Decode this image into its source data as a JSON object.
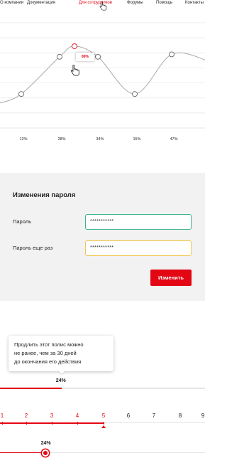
{
  "nav": {
    "items": [
      {
        "label": "О компании",
        "active": false
      },
      {
        "label": "Документация",
        "active": false
      },
      {
        "label": "Для сотрудников",
        "active": true
      },
      {
        "label": "Форумы",
        "active": false
      },
      {
        "label": "Помощь",
        "active": false
      },
      {
        "label": "Контакты",
        "active": false
      }
    ]
  },
  "chart_data": {
    "type": "line",
    "categories": [
      "12%",
      "28%",
      "34%",
      "15%",
      "47%"
    ],
    "points": [
      {
        "category": "12%",
        "value": 42
      },
      {
        "category": "28%",
        "value": 88
      },
      {
        "category": "",
        "value": 101
      },
      {
        "category": "34%",
        "value": 88
      },
      {
        "category": "15%",
        "value": 42
      },
      {
        "category": "47%",
        "value": 91
      }
    ],
    "tooltip": {
      "label": "89%"
    },
    "colors": {
      "line": "#aaaaaa",
      "grid": "#e6e6e6",
      "highlight": "#e30613"
    },
    "grid": true,
    "ylim": [
      0,
      130
    ]
  },
  "password_form": {
    "title": "Изменения пароля",
    "password_label": "Пароль",
    "password_value": "***********",
    "repeat_label": "Пароль еще раз",
    "repeat_value": "***********",
    "submit_label": "Изменить"
  },
  "hint": {
    "text_line1": "Продлить этот полис можно",
    "text_line2": "не ранее, чем за 30 дней",
    "text_line3": "до окончания его действия"
  },
  "progress": {
    "label": "24%",
    "value": 0.3
  },
  "steps": {
    "items": [
      "1",
      "2",
      "3",
      "4",
      "5",
      "6",
      "7",
      "8",
      "9"
    ],
    "current": 5
  },
  "slider": {
    "label": "24%",
    "value": 0.22
  },
  "colors": {
    "accent": "#e30613",
    "success": "#38b48b",
    "warning": "#f0c850",
    "panel": "#f2f2f2"
  },
  "icons": {
    "cursor": "hand-pointer-icon"
  }
}
